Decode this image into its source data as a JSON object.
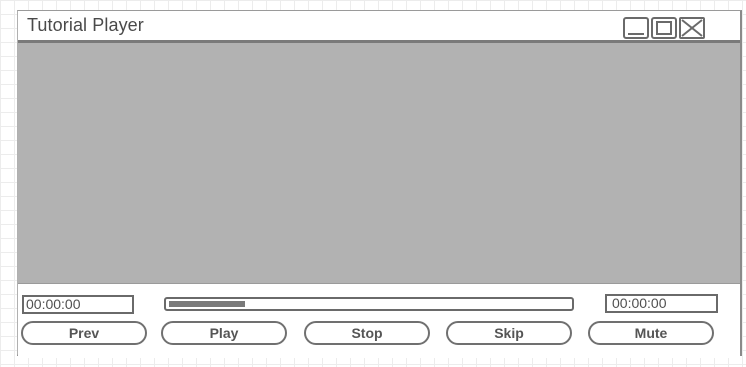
{
  "window": {
    "title": "Tutorial Player"
  },
  "title_bar_icons": {
    "minimize": "minimize-icon",
    "maximize": "maximize-icon",
    "close": "close-icon"
  },
  "time": {
    "elapsed": "00:00:00",
    "total": "00:00:00"
  },
  "progress": {
    "fraction": 0.19
  },
  "controls": {
    "prev_label": "Prev",
    "play_label": "Play",
    "stop_label": "Stop",
    "skip_label": "Skip",
    "mute_label": "Mute"
  },
  "colors": {
    "video_area": "#b2b2b2",
    "border": "#6a6a6a",
    "progress_fill": "#7a7a7a"
  }
}
